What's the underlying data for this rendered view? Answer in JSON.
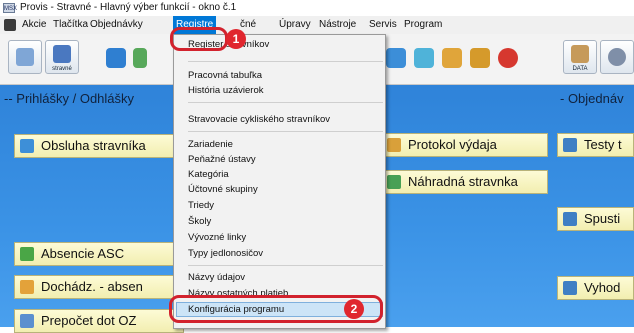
{
  "window": {
    "title": "Provis - Stravné - Hlavný výber funkcií - okno č.1",
    "app_icon_text": "MSX"
  },
  "menubar": {
    "items": [
      "Akcie",
      "Tlačítka",
      "Objednávky",
      "Registre",
      "čné",
      "Úpravy",
      "Nástroje",
      "Servis",
      "Program"
    ]
  },
  "toolbar": {
    "strav_caption": "stravné",
    "data_caption": "DATA"
  },
  "sections": {
    "left": "-- Prihlášky / Odhlášky",
    "right": "- Objednáv"
  },
  "buttons": {
    "obsluha": "Obsluha stravníka",
    "absencie": "Absencie ASC",
    "dochadz": "Dochádz. - absen",
    "prepocet": "Prepočet dot OZ",
    "protokol": "Protokol výdaja",
    "nahradna": "Náhradná stravnka",
    "testy": "Testy t",
    "spusti": "Spusti",
    "vyhod": "Vyhod"
  },
  "dropdown": {
    "items": [
      "Register stravníkov",
      "Pracovná tabuľka",
      "História uzávierok",
      "Stravovacie cykliského stravníkov",
      "Zariadenie",
      "Peňažné ústavy",
      "Kategória",
      "Účtovné skupiny",
      "Triedy",
      "Školy",
      "Vývozné linky",
      "Typy jedlonosičov",
      "Názvy údajov",
      "Názvy ostatných platieb",
      "Konfigurácia programu"
    ]
  },
  "annotations": {
    "badge1": "1",
    "badge2": "2"
  },
  "colors": {
    "highlight": "#0078d7",
    "annotation_red": "#d2222d",
    "button_fill": "#f5f1bd",
    "background_blue": "#3b8ee4"
  }
}
